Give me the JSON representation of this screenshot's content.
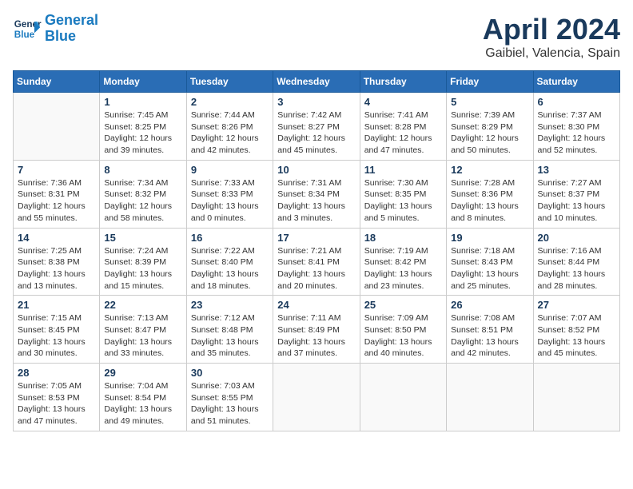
{
  "header": {
    "logo_line1": "General",
    "logo_line2": "Blue",
    "month_title": "April 2024",
    "location": "Gaibiel, Valencia, Spain"
  },
  "days_of_week": [
    "Sunday",
    "Monday",
    "Tuesday",
    "Wednesday",
    "Thursday",
    "Friday",
    "Saturday"
  ],
  "weeks": [
    [
      {
        "day": "",
        "info": ""
      },
      {
        "day": "1",
        "info": "Sunrise: 7:45 AM\nSunset: 8:25 PM\nDaylight: 12 hours\nand 39 minutes."
      },
      {
        "day": "2",
        "info": "Sunrise: 7:44 AM\nSunset: 8:26 PM\nDaylight: 12 hours\nand 42 minutes."
      },
      {
        "day": "3",
        "info": "Sunrise: 7:42 AM\nSunset: 8:27 PM\nDaylight: 12 hours\nand 45 minutes."
      },
      {
        "day": "4",
        "info": "Sunrise: 7:41 AM\nSunset: 8:28 PM\nDaylight: 12 hours\nand 47 minutes."
      },
      {
        "day": "5",
        "info": "Sunrise: 7:39 AM\nSunset: 8:29 PM\nDaylight: 12 hours\nand 50 minutes."
      },
      {
        "day": "6",
        "info": "Sunrise: 7:37 AM\nSunset: 8:30 PM\nDaylight: 12 hours\nand 52 minutes."
      }
    ],
    [
      {
        "day": "7",
        "info": "Sunrise: 7:36 AM\nSunset: 8:31 PM\nDaylight: 12 hours\nand 55 minutes."
      },
      {
        "day": "8",
        "info": "Sunrise: 7:34 AM\nSunset: 8:32 PM\nDaylight: 12 hours\nand 58 minutes."
      },
      {
        "day": "9",
        "info": "Sunrise: 7:33 AM\nSunset: 8:33 PM\nDaylight: 13 hours\nand 0 minutes."
      },
      {
        "day": "10",
        "info": "Sunrise: 7:31 AM\nSunset: 8:34 PM\nDaylight: 13 hours\nand 3 minutes."
      },
      {
        "day": "11",
        "info": "Sunrise: 7:30 AM\nSunset: 8:35 PM\nDaylight: 13 hours\nand 5 minutes."
      },
      {
        "day": "12",
        "info": "Sunrise: 7:28 AM\nSunset: 8:36 PM\nDaylight: 13 hours\nand 8 minutes."
      },
      {
        "day": "13",
        "info": "Sunrise: 7:27 AM\nSunset: 8:37 PM\nDaylight: 13 hours\nand 10 minutes."
      }
    ],
    [
      {
        "day": "14",
        "info": "Sunrise: 7:25 AM\nSunset: 8:38 PM\nDaylight: 13 hours\nand 13 minutes."
      },
      {
        "day": "15",
        "info": "Sunrise: 7:24 AM\nSunset: 8:39 PM\nDaylight: 13 hours\nand 15 minutes."
      },
      {
        "day": "16",
        "info": "Sunrise: 7:22 AM\nSunset: 8:40 PM\nDaylight: 13 hours\nand 18 minutes."
      },
      {
        "day": "17",
        "info": "Sunrise: 7:21 AM\nSunset: 8:41 PM\nDaylight: 13 hours\nand 20 minutes."
      },
      {
        "day": "18",
        "info": "Sunrise: 7:19 AM\nSunset: 8:42 PM\nDaylight: 13 hours\nand 23 minutes."
      },
      {
        "day": "19",
        "info": "Sunrise: 7:18 AM\nSunset: 8:43 PM\nDaylight: 13 hours\nand 25 minutes."
      },
      {
        "day": "20",
        "info": "Sunrise: 7:16 AM\nSunset: 8:44 PM\nDaylight: 13 hours\nand 28 minutes."
      }
    ],
    [
      {
        "day": "21",
        "info": "Sunrise: 7:15 AM\nSunset: 8:45 PM\nDaylight: 13 hours\nand 30 minutes."
      },
      {
        "day": "22",
        "info": "Sunrise: 7:13 AM\nSunset: 8:47 PM\nDaylight: 13 hours\nand 33 minutes."
      },
      {
        "day": "23",
        "info": "Sunrise: 7:12 AM\nSunset: 8:48 PM\nDaylight: 13 hours\nand 35 minutes."
      },
      {
        "day": "24",
        "info": "Sunrise: 7:11 AM\nSunset: 8:49 PM\nDaylight: 13 hours\nand 37 minutes."
      },
      {
        "day": "25",
        "info": "Sunrise: 7:09 AM\nSunset: 8:50 PM\nDaylight: 13 hours\nand 40 minutes."
      },
      {
        "day": "26",
        "info": "Sunrise: 7:08 AM\nSunset: 8:51 PM\nDaylight: 13 hours\nand 42 minutes."
      },
      {
        "day": "27",
        "info": "Sunrise: 7:07 AM\nSunset: 8:52 PM\nDaylight: 13 hours\nand 45 minutes."
      }
    ],
    [
      {
        "day": "28",
        "info": "Sunrise: 7:05 AM\nSunset: 8:53 PM\nDaylight: 13 hours\nand 47 minutes."
      },
      {
        "day": "29",
        "info": "Sunrise: 7:04 AM\nSunset: 8:54 PM\nDaylight: 13 hours\nand 49 minutes."
      },
      {
        "day": "30",
        "info": "Sunrise: 7:03 AM\nSunset: 8:55 PM\nDaylight: 13 hours\nand 51 minutes."
      },
      {
        "day": "",
        "info": ""
      },
      {
        "day": "",
        "info": ""
      },
      {
        "day": "",
        "info": ""
      },
      {
        "day": "",
        "info": ""
      }
    ]
  ]
}
